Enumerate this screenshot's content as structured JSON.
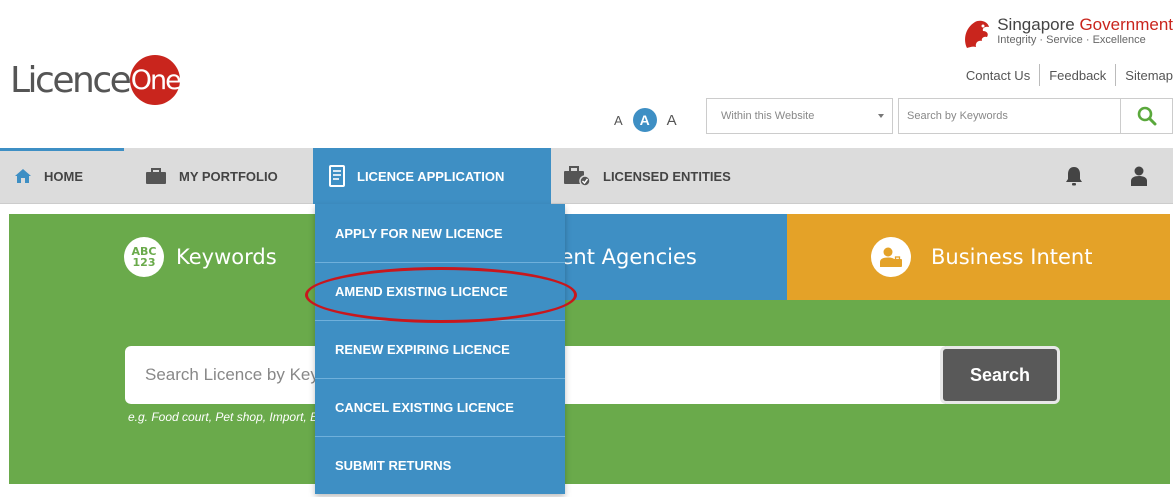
{
  "brand": {
    "logo_text": "Licence",
    "logo_highlight": "One"
  },
  "government": {
    "name_part1": "Singapore ",
    "name_part2": "Government",
    "tagline": "Integrity · Service · Excellence"
  },
  "utility_links": {
    "contact": "Contact Us",
    "feedback": "Feedback",
    "sitemap": "Sitemap"
  },
  "font_size": {
    "small": "A",
    "medium": "A",
    "large": "A"
  },
  "site_search": {
    "scope": "Within this Website",
    "placeholder": "Search by Keywords"
  },
  "nav": {
    "home": "HOME",
    "portfolio": "MY PORTFOLIO",
    "licence_application": "LICENCE APPLICATION",
    "licensed_entities": "LICENSED ENTITIES"
  },
  "dropdown": {
    "items": [
      "APPLY FOR NEW LICENCE",
      "AMEND EXISTING LICENCE",
      "RENEW EXPIRING LICENCE",
      "CANCEL EXISTING LICENCE",
      "SUBMIT RETURNS"
    ]
  },
  "hero": {
    "tabs": {
      "keywords": "Keywords",
      "agencies": "Government Agencies",
      "business": "Business Intent"
    },
    "keywords_badge": {
      "line1": "ABC",
      "line2": "123"
    },
    "search_placeholder": "Search Licence by Keywords",
    "search_button": "Search",
    "example": "e.g. Food court, Pet shop, Import, Export"
  },
  "colors": {
    "accent_blue": "#3e8fc4",
    "green": "#6aaa4b",
    "orange": "#e4a228",
    "brand_red": "#c9251d"
  }
}
